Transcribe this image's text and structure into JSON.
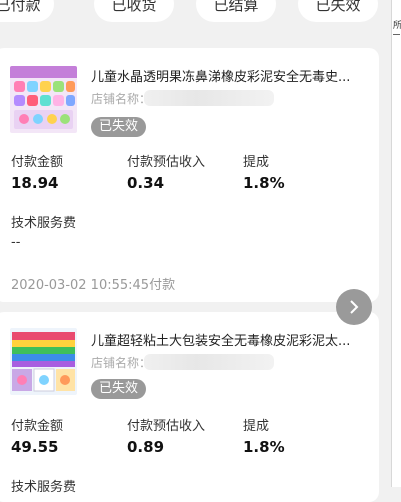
{
  "tabs": [
    {
      "label": "已付款"
    },
    {
      "label": "已收货"
    },
    {
      "label": "已结算"
    },
    {
      "label": "已失效"
    }
  ],
  "side_panel": {
    "char": "所"
  },
  "labels": {
    "paid_amount": "付款金额",
    "est_income": "付款预估收入",
    "commission": "提成",
    "service_fee": "技术服务费",
    "shop_name": "店铺名称："
  },
  "orders": [
    {
      "title": "儿童水晶透明果冻鼻涕橡皮彩泥安全无毒史...",
      "status": "已失效",
      "paid": "18.94",
      "income": "0.34",
      "rate": "1.8%",
      "service_fee": "--",
      "time": "2020-03-02 10:55:45付款"
    },
    {
      "title": "儿童超轻粘土大包装安全无毒橡皮泥彩泥太...",
      "status": "已失效",
      "paid": "49.55",
      "income": "0.89",
      "rate": "1.8%",
      "service_fee_label_partial": "技术服务费"
    }
  ]
}
